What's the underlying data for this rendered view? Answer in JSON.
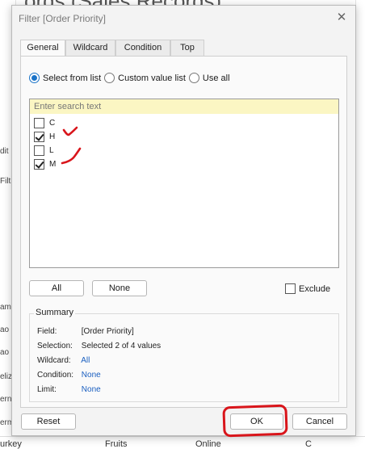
{
  "background": {
    "title": "ords (Sales Records)",
    "left_fragments": [
      "dit",
      "Filt",
      "am",
      "ao",
      "ao",
      "eliz",
      "ern",
      "ern",
      "erm",
      "urkey"
    ],
    "bottom_row": [
      "urkey",
      "Fruits",
      "Online",
      "C"
    ]
  },
  "dialog": {
    "title": "Filter [Order Priority]",
    "close_glyph": "✕",
    "tabs": [
      "General",
      "Wildcard",
      "Condition",
      "Top"
    ],
    "active_tab": "General",
    "radio_options": [
      {
        "label": "Select from list",
        "checked": true
      },
      {
        "label": "Custom value list",
        "checked": false
      },
      {
        "label": "Use all",
        "checked": false
      }
    ],
    "search_placeholder": "Enter search text",
    "items": [
      {
        "label": "C",
        "checked": false
      },
      {
        "label": "H",
        "checked": true
      },
      {
        "label": "L",
        "checked": false
      },
      {
        "label": "M",
        "checked": true
      }
    ],
    "all_button": "All",
    "none_button": "None",
    "exclude_label": "Exclude",
    "exclude_checked": false,
    "summary": {
      "title": "Summary",
      "rows": [
        {
          "key": "Field:",
          "value": "[Order Priority]"
        },
        {
          "key": "Selection:",
          "value": "Selected 2 of 4 values"
        },
        {
          "key": "Wildcard:",
          "value": "All"
        },
        {
          "key": "Condition:",
          "value": "None"
        },
        {
          "key": "Limit:",
          "value": "None"
        }
      ]
    },
    "reset_button": "Reset",
    "ok_button": "OK",
    "cancel_button": "Cancel"
  },
  "colors": {
    "accent": "#1a73c8",
    "search_bg": "#fbf6c3",
    "annotation": "#d9151b",
    "link": "#1a5fc0"
  }
}
